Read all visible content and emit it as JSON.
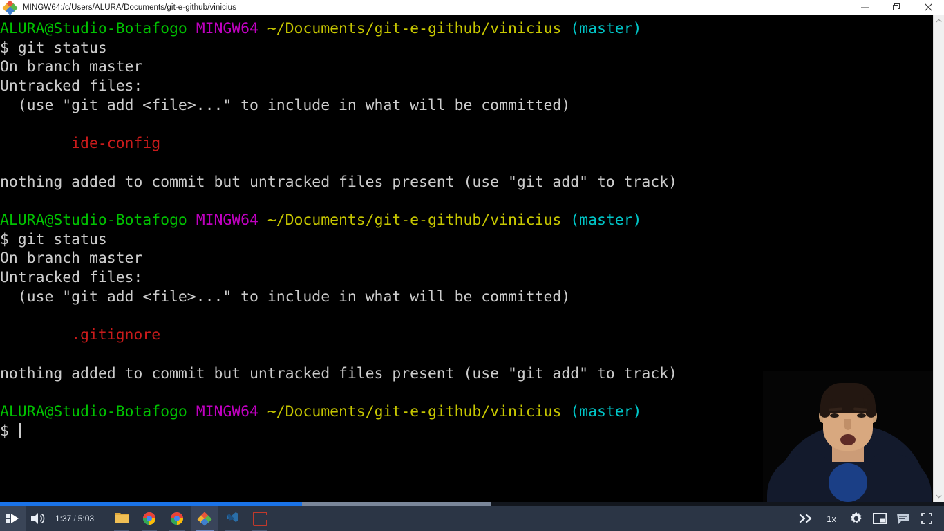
{
  "window": {
    "title": "MINGW64:/c/Users/ALURA/Documents/git-e-github/vinicius",
    "icon": "git-bash-logo",
    "controls": {
      "minimize": "minimize",
      "restore": "restore",
      "close": "close"
    }
  },
  "terminal": {
    "lines": [
      {
        "id": "prompt1",
        "segments": [
          {
            "text": "ALURA@Studio-Botafogo",
            "color": "green"
          },
          {
            "text": " ",
            "color": "gray"
          },
          {
            "text": "MINGW64",
            "color": "magenta"
          },
          {
            "text": " ",
            "color": "gray"
          },
          {
            "text": "~/Documents/git-e-github/vinicius",
            "color": "yellow"
          },
          {
            "text": " ",
            "color": "gray"
          },
          {
            "text": "(master)",
            "color": "cyan"
          }
        ]
      },
      {
        "id": "cmd1",
        "segments": [
          {
            "text": "$ git status",
            "color": "gray"
          }
        ]
      },
      {
        "id": "out1",
        "segments": [
          {
            "text": "On branch master",
            "color": "gray"
          }
        ]
      },
      {
        "id": "out2",
        "segments": [
          {
            "text": "Untracked files:",
            "color": "gray"
          }
        ]
      },
      {
        "id": "out3",
        "segments": [
          {
            "text": "  (use \"git add <file>...\" to include in what will be committed)",
            "color": "gray"
          }
        ]
      },
      {
        "id": "blank1",
        "segments": [
          {
            "text": " ",
            "color": "gray"
          }
        ]
      },
      {
        "id": "file1",
        "segments": [
          {
            "text": "        ide-config",
            "color": "red"
          }
        ]
      },
      {
        "id": "blank2",
        "segments": [
          {
            "text": " ",
            "color": "gray"
          }
        ]
      },
      {
        "id": "out4",
        "segments": [
          {
            "text": "nothing added to commit but untracked files present (use \"git add\" to track)",
            "color": "gray"
          }
        ]
      },
      {
        "id": "blank3",
        "segments": [
          {
            "text": " ",
            "color": "gray"
          }
        ]
      },
      {
        "id": "prompt2",
        "segments": [
          {
            "text": "ALURA@Studio-Botafogo",
            "color": "green"
          },
          {
            "text": " ",
            "color": "gray"
          },
          {
            "text": "MINGW64",
            "color": "magenta"
          },
          {
            "text": " ",
            "color": "gray"
          },
          {
            "text": "~/Documents/git-e-github/vinicius",
            "color": "yellow"
          },
          {
            "text": " ",
            "color": "gray"
          },
          {
            "text": "(master)",
            "color": "cyan"
          }
        ]
      },
      {
        "id": "cmd2",
        "segments": [
          {
            "text": "$ git status",
            "color": "gray"
          }
        ]
      },
      {
        "id": "out5",
        "segments": [
          {
            "text": "On branch master",
            "color": "gray"
          }
        ]
      },
      {
        "id": "out6",
        "segments": [
          {
            "text": "Untracked files:",
            "color": "gray"
          }
        ]
      },
      {
        "id": "out7",
        "segments": [
          {
            "text": "  (use \"git add <file>...\" to include in what will be committed)",
            "color": "gray"
          }
        ]
      },
      {
        "id": "blank4",
        "segments": [
          {
            "text": " ",
            "color": "gray"
          }
        ]
      },
      {
        "id": "file2",
        "segments": [
          {
            "text": "        .gitignore",
            "color": "red"
          }
        ]
      },
      {
        "id": "blank5",
        "segments": [
          {
            "text": " ",
            "color": "gray"
          }
        ]
      },
      {
        "id": "out8",
        "segments": [
          {
            "text": "nothing added to commit but untracked files present (use \"git add\" to track)",
            "color": "gray"
          }
        ]
      },
      {
        "id": "blank6",
        "segments": [
          {
            "text": " ",
            "color": "gray"
          }
        ]
      },
      {
        "id": "prompt3",
        "segments": [
          {
            "text": "ALURA@Studio-Botafogo",
            "color": "green"
          },
          {
            "text": " ",
            "color": "gray"
          },
          {
            "text": "MINGW64",
            "color": "magenta"
          },
          {
            "text": " ",
            "color": "gray"
          },
          {
            "text": "~/Documents/git-e-github/vinicius",
            "color": "yellow"
          },
          {
            "text": " ",
            "color": "gray"
          },
          {
            "text": "(master)",
            "color": "cyan"
          }
        ]
      },
      {
        "id": "cmd3",
        "segments": [
          {
            "text": "$ ",
            "color": "gray"
          }
        ],
        "cursor": true
      }
    ],
    "colors": {
      "background": "#000000",
      "foreground": "#cccccc",
      "green": "#00c200",
      "magenta": "#c000c0",
      "yellow": "#c7c700",
      "cyan": "#00c5c7",
      "red": "#c91b1b"
    }
  },
  "player": {
    "play_label": "play",
    "volume_label": "volume",
    "current_time": "1:37",
    "time_separator": "/",
    "total_time": "5:03",
    "speed": "1x",
    "forward_label": "fast-forward",
    "settings_label": "settings",
    "pip_label": "picture-in-picture",
    "captions_label": "captions",
    "fullscreen_label": "fullscreen",
    "progress_percent": 32,
    "buffered_percent": 52,
    "accent_color": "#1a73e8",
    "bar_color": "#2b3545"
  },
  "taskbar": {
    "items": [
      {
        "name": "file-explorer",
        "icon": "folder-icon",
        "active": false
      },
      {
        "name": "chrome-1",
        "icon": "chrome-icon",
        "active": false
      },
      {
        "name": "chrome-2",
        "icon": "chrome-icon",
        "active": false
      },
      {
        "name": "git-bash",
        "icon": "git-bash-icon",
        "active": true
      },
      {
        "name": "vscode",
        "icon": "vscode-icon",
        "active": false
      },
      {
        "name": "app-red",
        "icon": "red-app-icon",
        "active": false
      }
    ]
  },
  "scrollbar": {
    "up_arrow": "scroll-up",
    "down_arrow": "scroll-down"
  }
}
